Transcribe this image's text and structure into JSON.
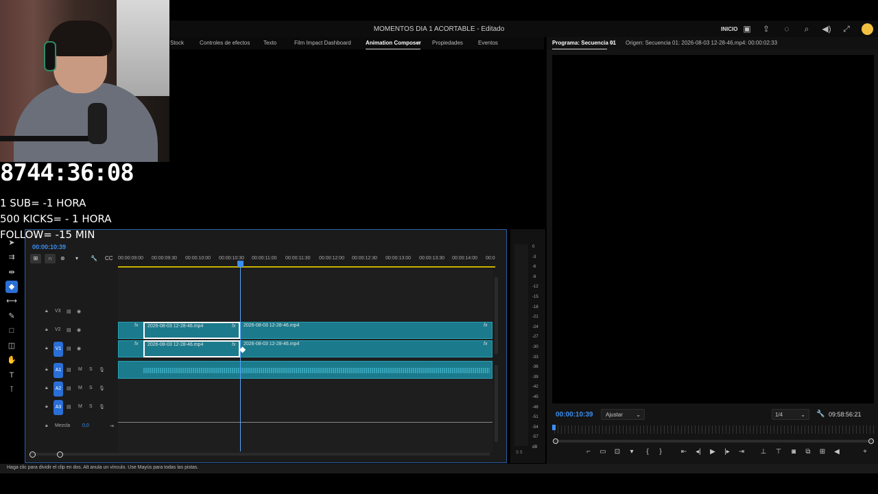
{
  "app": {
    "title": "MOMENTOS DIA 1 ACORTABLE - Editado",
    "inicio": "INICIO"
  },
  "effects_panel": {
    "tabs": [
      "Stock",
      "Controles de efectos",
      "Texto",
      "Film Impact Dashboard",
      "Animation Composer",
      "Propiedades",
      "Eventos"
    ],
    "active_tab": "Animation Composer"
  },
  "program_monitor": {
    "tab_program": "Programa: Secuencia 01",
    "tab_source": "Origen: Secuencia 01: 2026-08-03 12-28-46.mp4: 00:00:02:33",
    "timecode": "00:00:10:39",
    "fit": "Ajustar",
    "resolution": "1/4",
    "duration": "09:58:56:21"
  },
  "timeline": {
    "timecode": "00:00:10:39",
    "ruler": [
      "00:00:09:00",
      "00:00:09:30",
      "00:00:10:00",
      "00:00:10:30",
      "00:00:11:00",
      "00:00:11:30",
      "00:00:12:00",
      "00:00:12:30",
      "00:00:13:00",
      "00:00:13:30",
      "00:00:14:00",
      "00:0"
    ],
    "tracks": {
      "v3": "V3",
      "v2": "V2",
      "v1": "V1",
      "a1": "A1",
      "a2": "A2",
      "a3": "A3",
      "mix": "Mezcla",
      "mix_value": "0,0"
    },
    "clip_name": "2026-08-03 12-28-46.mp4",
    "fx": "fx",
    "mute": "M",
    "solo": "S"
  },
  "meter": {
    "labels": [
      "0",
      "-3",
      "-6",
      "-9",
      "-12",
      "-15",
      "-18",
      "-21",
      "-24",
      "-27",
      "-30",
      "-33",
      "-36",
      "-39",
      "-42",
      "-45",
      "-48",
      "-51",
      "-54",
      "-57",
      "dB"
    ],
    "footer": "S S"
  },
  "status": {
    "text": "Haga clic para dividir el clip en dos. Alt anula un vínculo. Use Mayús para todas las pistas."
  },
  "overlay": {
    "timer": "8744:36:08",
    "rules": [
      "1 SUB= -1 HORA",
      "500 KICKS= - 1 HORA",
      "FOLLOW= -15 MIN"
    ]
  },
  "colors": {
    "accent": "#3b8ff0",
    "clip": "#1b7a8c",
    "track_highlight": "#2a6fd6"
  }
}
